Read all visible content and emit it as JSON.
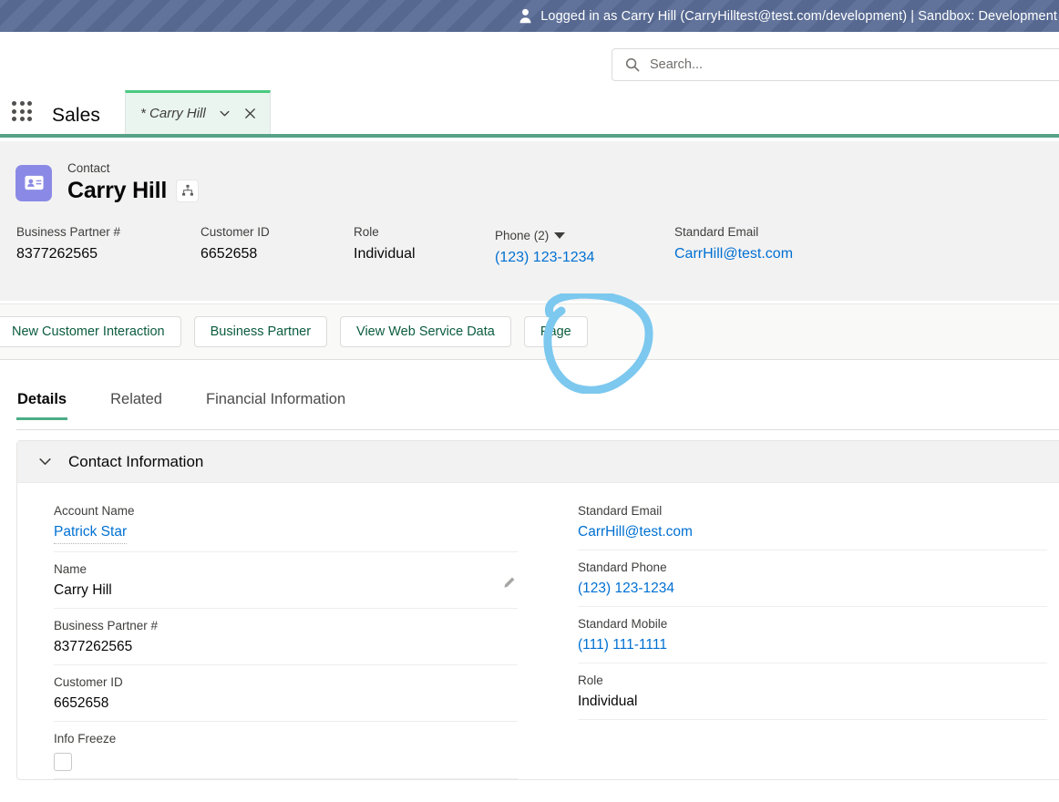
{
  "sandbox_banner": {
    "icon": "person-icon",
    "text": "Logged in as Carry Hill (CarryHilltest@test.com/development) | Sandbox: Development"
  },
  "search": {
    "icon": "search-icon",
    "placeholder": "Search..."
  },
  "app_nav": {
    "launcher_icon": "app-launcher-grid-icon",
    "app_name": "Sales",
    "tab": {
      "label": "* Carry Hill",
      "dropdown_icon": "chevron-down-icon",
      "close_icon": "close-icon"
    }
  },
  "record_header": {
    "avatar_icon": "contact-card-icon",
    "object_type": "Contact",
    "record_name": "Carry Hill",
    "hierarchy_icon": "hierarchy-icon",
    "fields": [
      {
        "label": "Business Partner #",
        "value": "8377262565",
        "link": false,
        "dropdown": false
      },
      {
        "label": "Customer ID",
        "value": "6652658",
        "link": false,
        "dropdown": false
      },
      {
        "label": "Role",
        "value": "Individual",
        "link": false,
        "dropdown": false
      },
      {
        "label": "Phone (2)",
        "value": "(123) 123-1234",
        "link": true,
        "dropdown": true
      },
      {
        "label": "Standard Email",
        "value": "CarrHill@test.com",
        "link": true,
        "dropdown": false
      }
    ]
  },
  "actions": [
    {
      "label": "New Customer Interaction",
      "highlighted": false
    },
    {
      "label": "Business Partner",
      "highlighted": false
    },
    {
      "label": "View Web Service Data",
      "highlighted": false
    },
    {
      "label": "Page",
      "highlighted": true
    }
  ],
  "annotation": {
    "shape": "hand-drawn-circle",
    "target": "Page",
    "color": "#7cc8ef"
  },
  "detail_tabs": [
    {
      "label": "Details",
      "active": true
    },
    {
      "label": "Related",
      "active": false
    },
    {
      "label": "Financial Information",
      "active": false
    }
  ],
  "details_section": {
    "title": "Contact Information",
    "collapse_icon": "chevron-down-icon",
    "left_fields": [
      {
        "label": "Account Name",
        "value": "Patrick Star",
        "type": "link-dotted",
        "edit_icon": false
      },
      {
        "label": "Name",
        "value": "Carry Hill",
        "type": "text",
        "edit_icon": true
      },
      {
        "label": "Business Partner #",
        "value": "8377262565",
        "type": "text",
        "edit_icon": false
      },
      {
        "label": "Customer ID",
        "value": "6652658",
        "type": "text",
        "edit_icon": false
      },
      {
        "label": "Info Freeze",
        "value": "",
        "type": "checkbox",
        "checked": false,
        "edit_icon": false
      }
    ],
    "right_fields": [
      {
        "label": "Standard Email",
        "value": "CarrHill@test.com",
        "type": "link",
        "edit_icon": false
      },
      {
        "label": "Standard Phone",
        "value": "(123) 123-1234",
        "type": "link",
        "edit_icon": false
      },
      {
        "label": "Standard Mobile",
        "value": "(111) 111-1111",
        "type": "link",
        "edit_icon": false
      },
      {
        "label": "Role",
        "value": "Individual",
        "type": "text",
        "edit_icon": false
      }
    ]
  },
  "theme": {
    "sandbox_bg": "#5a6d96",
    "brand_green": "#4bca81",
    "link_blue": "#0070d2",
    "avatar_purple": "#8a8ae6",
    "action_text": "#0b5c3f"
  }
}
